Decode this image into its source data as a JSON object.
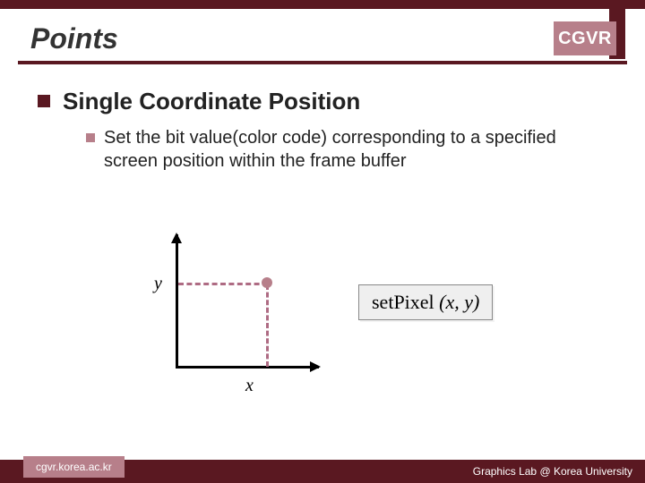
{
  "header": {
    "title": "Points",
    "badge": "CGVR"
  },
  "content": {
    "lvl1": "Single Coordinate Position",
    "lvl2": "Set the bit value(color code) corresponding to a specified screen position within the frame buffer"
  },
  "diagram": {
    "ylabel": "y",
    "xlabel": "x"
  },
  "callout": {
    "fn": "setPixel",
    "args": "(x, y)"
  },
  "footer": {
    "left": "cgvr.korea.ac.kr",
    "right": "Graphics Lab @ Korea University"
  }
}
